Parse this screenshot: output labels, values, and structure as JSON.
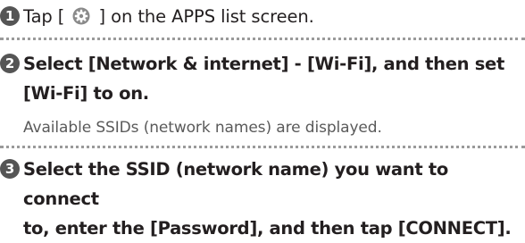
{
  "steps": [
    {
      "number": "1",
      "before_icon": "Tap [",
      "icon": "settings-gear-icon",
      "after_icon": "] on the APPS list screen."
    },
    {
      "number": "2",
      "line1": "Select [Network & internet] - [Wi-Fi], and then set",
      "line2": "[Wi-Fi] to on.",
      "note": "Available SSIDs (network names) are displayed."
    },
    {
      "number": "3",
      "line1": "Select the SSID (network name) you want to connect",
      "line2": "to, enter the [Password], and then tap [CONNECT]."
    }
  ],
  "colors": {
    "text": "#231f20",
    "badge": "#555555",
    "note": "#5a5a5a",
    "separator": "#9a9a9a"
  }
}
